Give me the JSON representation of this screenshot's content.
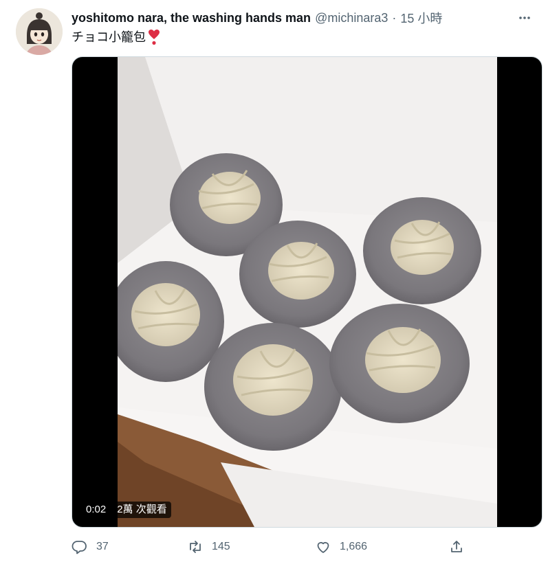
{
  "author": {
    "display_name": "yoshitomo nara, the washing hands man",
    "handle": "@michinara3",
    "separator": "·",
    "time": "15 小時"
  },
  "tweet": {
    "text": "チョコ小籠包",
    "emoji": "heavy-heart-exclamation"
  },
  "video": {
    "elapsed": "0:02",
    "views": "2萬 次觀看"
  },
  "actions": {
    "reply_count": "37",
    "retweet_count": "145",
    "like_count": "1,666"
  },
  "colors": {
    "text": "#0f1419",
    "secondary": "#536471",
    "heart_emoji": "#dd2e44"
  }
}
